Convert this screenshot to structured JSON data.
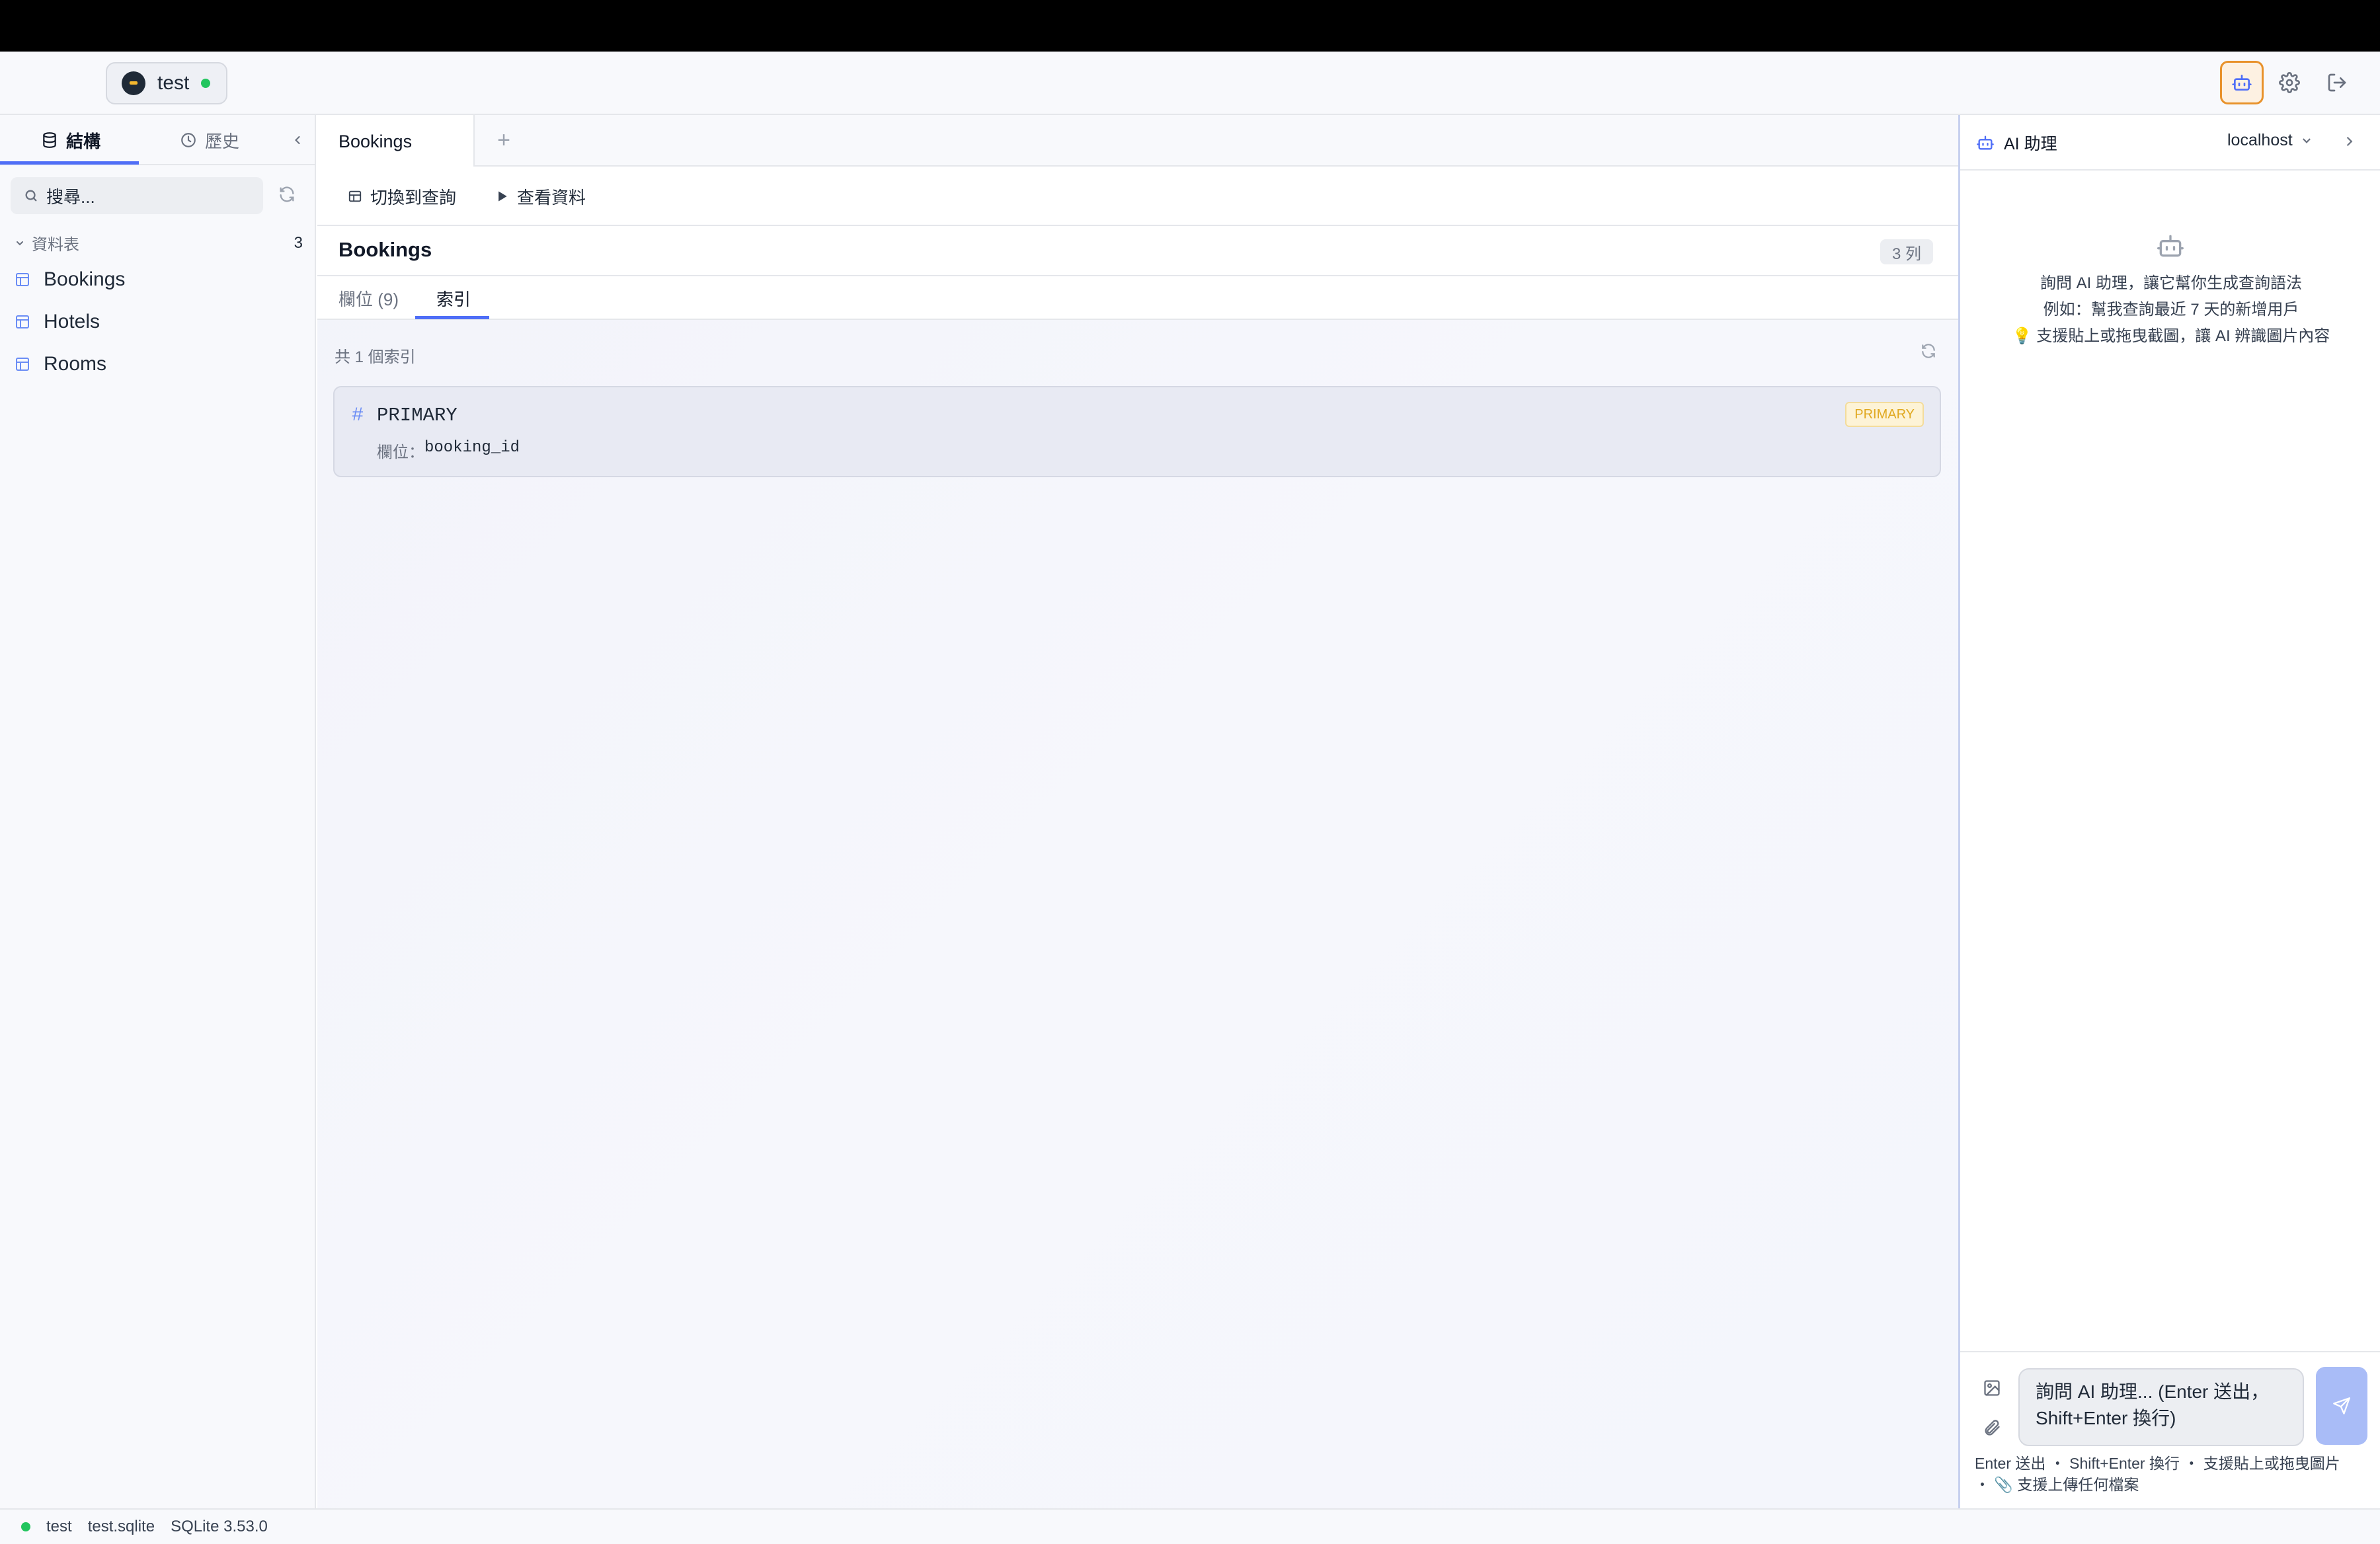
{
  "header": {
    "connection_name": "test",
    "status_color": "#22c55e",
    "active_accent": "#e8922b"
  },
  "sidebar": {
    "tabs": [
      {
        "label": "結構",
        "icon": "database-icon",
        "active": true
      },
      {
        "label": "歷史",
        "icon": "clock-icon",
        "active": false
      }
    ],
    "search_placeholder": "搜尋...",
    "section_label": "資料表",
    "section_count": "3",
    "tables": [
      "Bookings",
      "Hotels",
      "Rooms"
    ]
  },
  "main": {
    "tabs": [
      {
        "label": "Bookings"
      }
    ],
    "add_tab": "+",
    "toolbar": {
      "switch_query": "切換到查詢",
      "view_data": "查看資料"
    },
    "table_title": "Bookings",
    "row_count": "3 列",
    "subtabs": [
      {
        "label": "欄位 (9)",
        "active": false
      },
      {
        "label": "索引",
        "active": true
      }
    ],
    "index_summary": "共 1 個索引",
    "indexes": [
      {
        "hash": "#",
        "name": "PRIMARY",
        "columns_label": "欄位：",
        "columns": "booking_id",
        "tag": "PRIMARY"
      }
    ],
    "accent_color": "#4f6ef7"
  },
  "assistant": {
    "title": "AI 助理",
    "host": "localhost",
    "empty_lines": [
      "詢問 AI 助理，讓它幫你生成查詢語法",
      "例如：幫我查詢最近 7 天的新增用戶",
      "💡 支援貼上或拖曳截圖，讓 AI 辨識圖片內容"
    ],
    "input_placeholder": "詢問 AI 助理... (Enter 送出，Shift+Enter 換行)",
    "hint_line1": "Enter 送出 ・ Shift+Enter 換行 ・ 支援貼上或拖曳圖片",
    "hint_line2": "・ 📎 支援上傳任何檔案"
  },
  "statusbar": {
    "connection": "test",
    "file": "test.sqlite",
    "version": "SQLite 3.53.0"
  }
}
